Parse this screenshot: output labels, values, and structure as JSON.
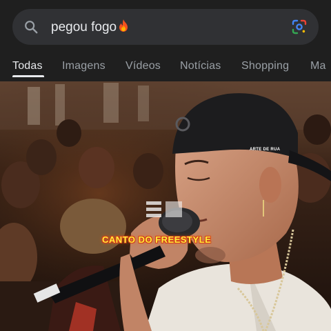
{
  "search": {
    "query": "pegou fogo",
    "trailing_emoji": "flame-icon"
  },
  "tabs": [
    {
      "label": "Todas",
      "active": true
    },
    {
      "label": "Imagens",
      "active": false
    },
    {
      "label": "Vídeos",
      "active": false
    },
    {
      "label": "Notícias",
      "active": false
    },
    {
      "label": "Shopping",
      "active": false
    },
    {
      "label": "Ma",
      "active": false
    }
  ],
  "video": {
    "caption": "CANTO DO FREESTYLE",
    "hat_text": "ARTE DE RUA"
  },
  "colors": {
    "background": "#1f1f1f",
    "search_pill": "#303134",
    "active_tab": "#e8eaed",
    "inactive_tab": "#9aa0a6",
    "caption_fill": "#ffef3a",
    "caption_stroke": "#d43a1a"
  }
}
